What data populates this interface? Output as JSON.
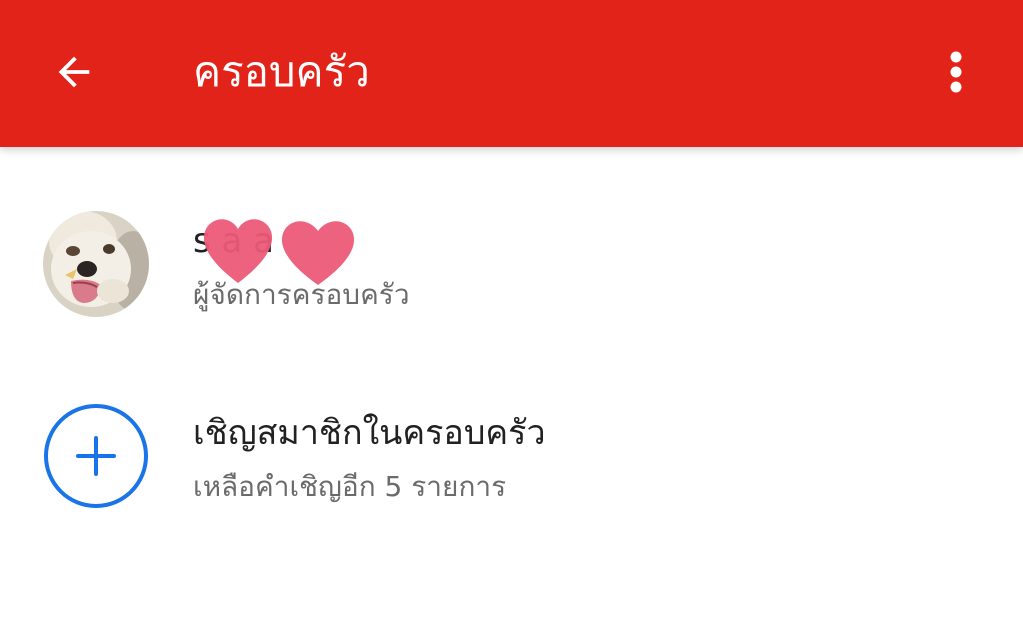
{
  "appbar": {
    "title": "ครอบครัว",
    "back_icon": "arrow-back-icon",
    "overflow_icon": "more-vert-icon",
    "color": "#e2231a"
  },
  "owner": {
    "name": "s   a   a",
    "role": "ผู้จัดการครอบครัว",
    "avatar_icon": "dog-avatar",
    "redaction_icon": "heart-sticker-icon",
    "redaction_color": "#ec5a78"
  },
  "invite": {
    "label": "เชิญสมาชิกในครอบครัว",
    "remaining": "เหลือคำเชิญอีก 5 รายการ",
    "icon": "add-circle-icon",
    "icon_color": "#1a73e8"
  }
}
